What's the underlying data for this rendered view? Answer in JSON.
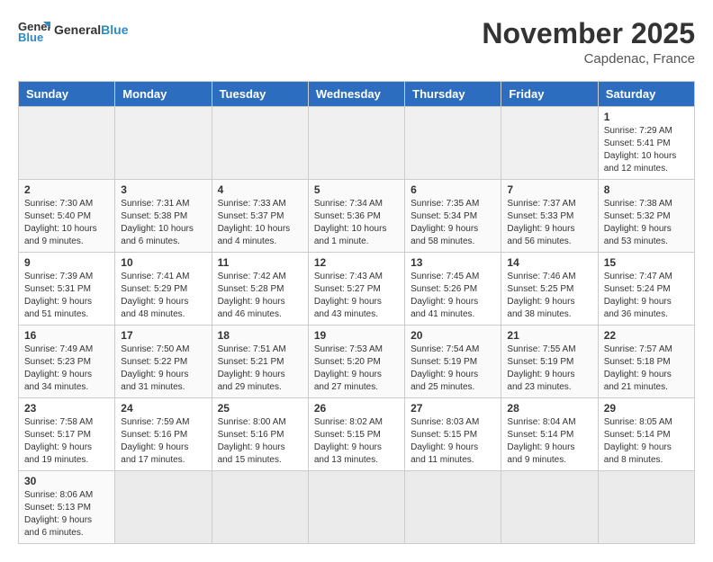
{
  "header": {
    "logo_general": "General",
    "logo_blue": "Blue",
    "month_year": "November 2025",
    "location": "Capdenac, France"
  },
  "days_of_week": [
    "Sunday",
    "Monday",
    "Tuesday",
    "Wednesday",
    "Thursday",
    "Friday",
    "Saturday"
  ],
  "weeks": [
    {
      "days": [
        {
          "empty": true
        },
        {
          "empty": true
        },
        {
          "empty": true
        },
        {
          "empty": true
        },
        {
          "empty": true
        },
        {
          "empty": true
        },
        {
          "number": "1",
          "sunrise": "Sunrise: 7:29 AM",
          "sunset": "Sunset: 5:41 PM",
          "daylight": "Daylight: 10 hours and 12 minutes."
        }
      ]
    },
    {
      "days": [
        {
          "number": "2",
          "sunrise": "Sunrise: 7:30 AM",
          "sunset": "Sunset: 5:40 PM",
          "daylight": "Daylight: 10 hours and 9 minutes."
        },
        {
          "number": "3",
          "sunrise": "Sunrise: 7:31 AM",
          "sunset": "Sunset: 5:38 PM",
          "daylight": "Daylight: 10 hours and 6 minutes."
        },
        {
          "number": "4",
          "sunrise": "Sunrise: 7:33 AM",
          "sunset": "Sunset: 5:37 PM",
          "daylight": "Daylight: 10 hours and 4 minutes."
        },
        {
          "number": "5",
          "sunrise": "Sunrise: 7:34 AM",
          "sunset": "Sunset: 5:36 PM",
          "daylight": "Daylight: 10 hours and 1 minute."
        },
        {
          "number": "6",
          "sunrise": "Sunrise: 7:35 AM",
          "sunset": "Sunset: 5:34 PM",
          "daylight": "Daylight: 9 hours and 58 minutes."
        },
        {
          "number": "7",
          "sunrise": "Sunrise: 7:37 AM",
          "sunset": "Sunset: 5:33 PM",
          "daylight": "Daylight: 9 hours and 56 minutes."
        },
        {
          "number": "8",
          "sunrise": "Sunrise: 7:38 AM",
          "sunset": "Sunset: 5:32 PM",
          "daylight": "Daylight: 9 hours and 53 minutes."
        }
      ]
    },
    {
      "days": [
        {
          "number": "9",
          "sunrise": "Sunrise: 7:39 AM",
          "sunset": "Sunset: 5:31 PM",
          "daylight": "Daylight: 9 hours and 51 minutes."
        },
        {
          "number": "10",
          "sunrise": "Sunrise: 7:41 AM",
          "sunset": "Sunset: 5:29 PM",
          "daylight": "Daylight: 9 hours and 48 minutes."
        },
        {
          "number": "11",
          "sunrise": "Sunrise: 7:42 AM",
          "sunset": "Sunset: 5:28 PM",
          "daylight": "Daylight: 9 hours and 46 minutes."
        },
        {
          "number": "12",
          "sunrise": "Sunrise: 7:43 AM",
          "sunset": "Sunset: 5:27 PM",
          "daylight": "Daylight: 9 hours and 43 minutes."
        },
        {
          "number": "13",
          "sunrise": "Sunrise: 7:45 AM",
          "sunset": "Sunset: 5:26 PM",
          "daylight": "Daylight: 9 hours and 41 minutes."
        },
        {
          "number": "14",
          "sunrise": "Sunrise: 7:46 AM",
          "sunset": "Sunset: 5:25 PM",
          "daylight": "Daylight: 9 hours and 38 minutes."
        },
        {
          "number": "15",
          "sunrise": "Sunrise: 7:47 AM",
          "sunset": "Sunset: 5:24 PM",
          "daylight": "Daylight: 9 hours and 36 minutes."
        }
      ]
    },
    {
      "days": [
        {
          "number": "16",
          "sunrise": "Sunrise: 7:49 AM",
          "sunset": "Sunset: 5:23 PM",
          "daylight": "Daylight: 9 hours and 34 minutes."
        },
        {
          "number": "17",
          "sunrise": "Sunrise: 7:50 AM",
          "sunset": "Sunset: 5:22 PM",
          "daylight": "Daylight: 9 hours and 31 minutes."
        },
        {
          "number": "18",
          "sunrise": "Sunrise: 7:51 AM",
          "sunset": "Sunset: 5:21 PM",
          "daylight": "Daylight: 9 hours and 29 minutes."
        },
        {
          "number": "19",
          "sunrise": "Sunrise: 7:53 AM",
          "sunset": "Sunset: 5:20 PM",
          "daylight": "Daylight: 9 hours and 27 minutes."
        },
        {
          "number": "20",
          "sunrise": "Sunrise: 7:54 AM",
          "sunset": "Sunset: 5:19 PM",
          "daylight": "Daylight: 9 hours and 25 minutes."
        },
        {
          "number": "21",
          "sunrise": "Sunrise: 7:55 AM",
          "sunset": "Sunset: 5:19 PM",
          "daylight": "Daylight: 9 hours and 23 minutes."
        },
        {
          "number": "22",
          "sunrise": "Sunrise: 7:57 AM",
          "sunset": "Sunset: 5:18 PM",
          "daylight": "Daylight: 9 hours and 21 minutes."
        }
      ]
    },
    {
      "days": [
        {
          "number": "23",
          "sunrise": "Sunrise: 7:58 AM",
          "sunset": "Sunset: 5:17 PM",
          "daylight": "Daylight: 9 hours and 19 minutes."
        },
        {
          "number": "24",
          "sunrise": "Sunrise: 7:59 AM",
          "sunset": "Sunset: 5:16 PM",
          "daylight": "Daylight: 9 hours and 17 minutes."
        },
        {
          "number": "25",
          "sunrise": "Sunrise: 8:00 AM",
          "sunset": "Sunset: 5:16 PM",
          "daylight": "Daylight: 9 hours and 15 minutes."
        },
        {
          "number": "26",
          "sunrise": "Sunrise: 8:02 AM",
          "sunset": "Sunset: 5:15 PM",
          "daylight": "Daylight: 9 hours and 13 minutes."
        },
        {
          "number": "27",
          "sunrise": "Sunrise: 8:03 AM",
          "sunset": "Sunset: 5:15 PM",
          "daylight": "Daylight: 9 hours and 11 minutes."
        },
        {
          "number": "28",
          "sunrise": "Sunrise: 8:04 AM",
          "sunset": "Sunset: 5:14 PM",
          "daylight": "Daylight: 9 hours and 9 minutes."
        },
        {
          "number": "29",
          "sunrise": "Sunrise: 8:05 AM",
          "sunset": "Sunset: 5:14 PM",
          "daylight": "Daylight: 9 hours and 8 minutes."
        }
      ]
    },
    {
      "days": [
        {
          "number": "30",
          "sunrise": "Sunrise: 8:06 AM",
          "sunset": "Sunset: 5:13 PM",
          "daylight": "Daylight: 9 hours and 6 minutes."
        },
        {
          "empty": true
        },
        {
          "empty": true
        },
        {
          "empty": true
        },
        {
          "empty": true
        },
        {
          "empty": true
        },
        {
          "empty": true
        }
      ]
    }
  ]
}
